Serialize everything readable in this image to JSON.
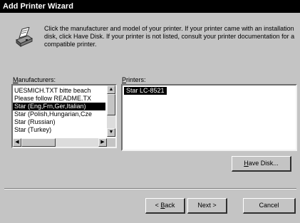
{
  "window": {
    "title": "Add Printer Wizard"
  },
  "instructions": {
    "icon": "printer-icon",
    "text": "Click the manufacturer and model of your printer. If your printer came with an installation disk, click Have Disk. If your printer is not listed, consult your printer documentation for a compatible printer."
  },
  "manufacturers": {
    "label_hotkey": "M",
    "label_rest": "anufacturers:",
    "items": [
      {
        "label": "UESMICH.TXT bitte beach"
      },
      {
        "label": "Please follow README.TX"
      },
      {
        "label": "Star (Eng,Frn,Ger,Italian)",
        "selected": true
      },
      {
        "label": "Star (Polish,Hungarian,Cze"
      },
      {
        "label": "Star (Russian)"
      },
      {
        "label": "Star (Turkey)"
      }
    ]
  },
  "printers": {
    "label_hotkey": "P",
    "label_rest": "rinters:",
    "items": [
      {
        "label": "Star LC-8521",
        "selected": true
      }
    ]
  },
  "buttons": {
    "have_disk_hotkey": "H",
    "have_disk_rest": "ave Disk...",
    "back_prefix": "< ",
    "back_hotkey": "B",
    "back_rest": "ack",
    "next_label": "Next >",
    "cancel_label": "Cancel"
  },
  "colors": {
    "dialog_face": "#c4c4c4",
    "titlebar": "#000000",
    "selection": "#000000"
  }
}
